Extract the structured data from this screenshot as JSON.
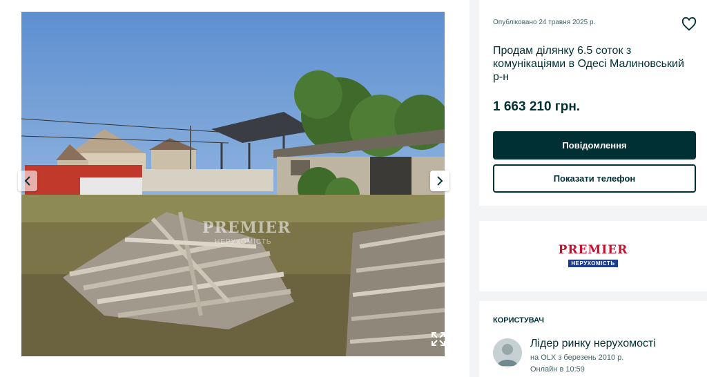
{
  "listing": {
    "posted": "Опубліковано 24 травня 2025 р.",
    "title": "Продам ділянку 6.5 соток з комунікаціями в Одесі Малиновський р-н",
    "price": "1 663 210 грн.",
    "message_button": "Повідомлення",
    "phone_button": "Показати телефон"
  },
  "gallery": {
    "watermark": "PREMIER",
    "watermark_sub": "НЕРУХОМІСТЬ"
  },
  "seller_logo": {
    "top": "PREMIER",
    "bottom": "НЕРУХОМІСТЬ"
  },
  "user": {
    "header": "Користувач",
    "name": "Лідер ринку нерухомості",
    "since": "на OLX з березень 2010 р.",
    "online": "Онлайн в 10:59"
  },
  "icons": {
    "favorite": "heart-icon",
    "prev": "chevron-left-icon",
    "next": "chevron-right-icon",
    "expand": "expand-icon"
  },
  "colors": {
    "brand_dark": "#002f34",
    "muted_text": "#406367",
    "background": "#f2f4f5"
  }
}
